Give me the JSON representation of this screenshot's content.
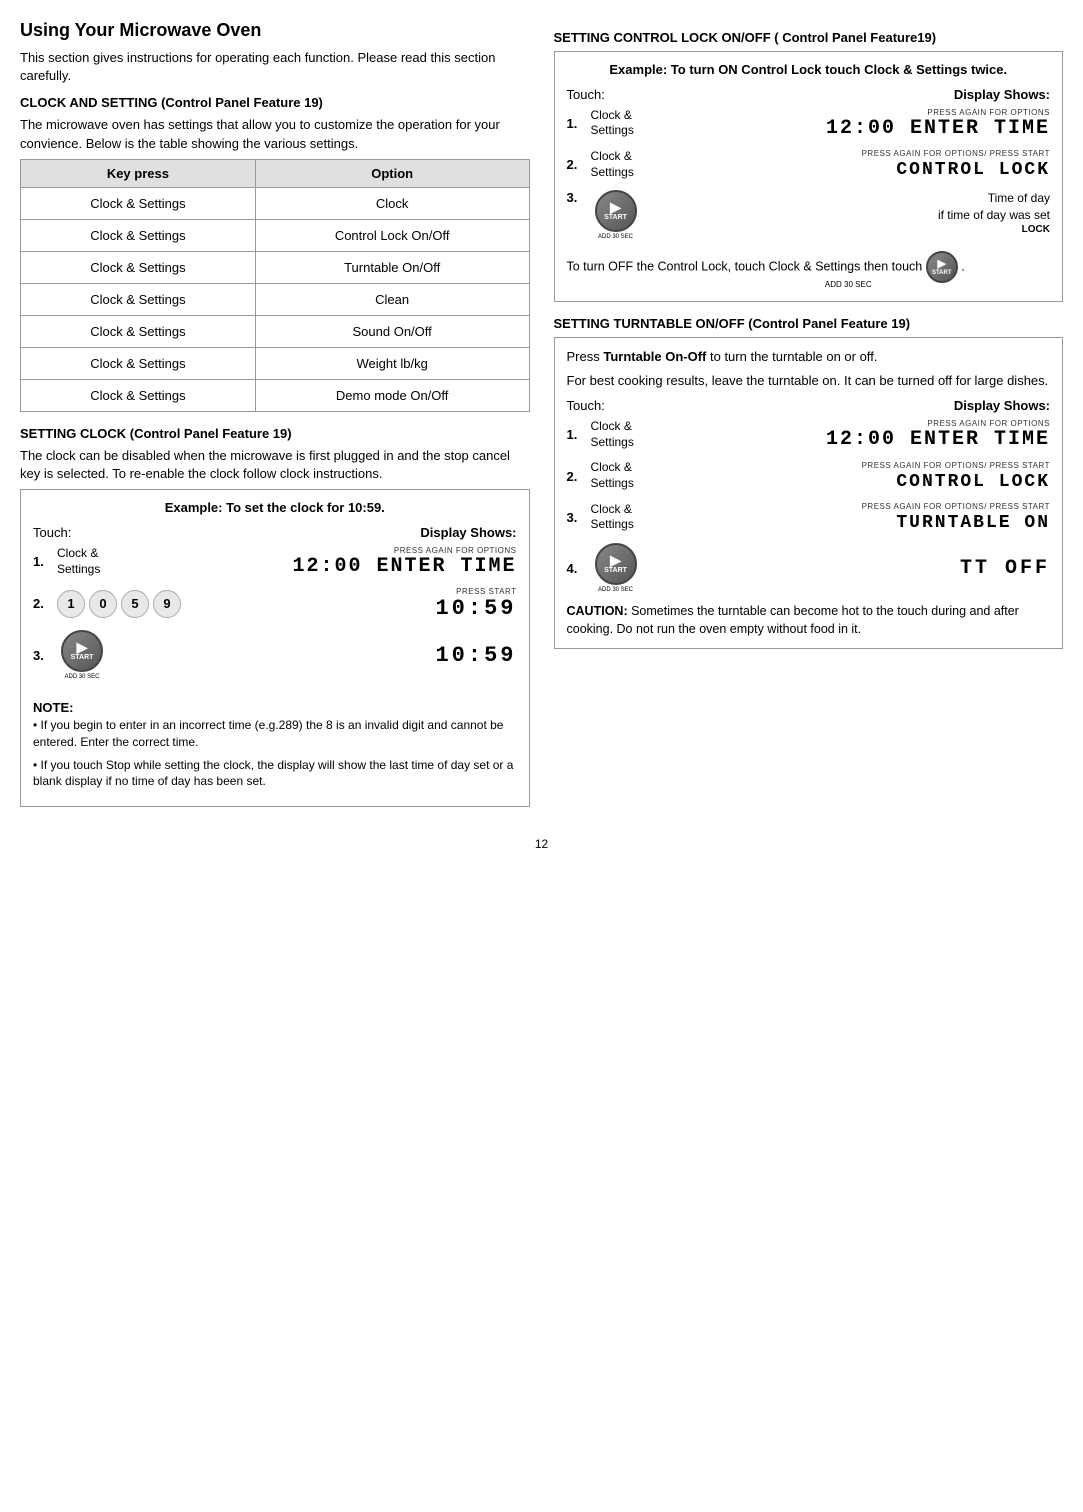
{
  "page": {
    "title": "Using Your Microwave Oven",
    "intro": "This section gives instructions for operating each function. Please read this section carefully.",
    "clock_section_title": "CLOCK AND SETTING (Control Panel Feature 19)",
    "clock_section_intro": "The microwave oven has settings that allow you to customize the operation for your convience. Below is the table showing the various settings.",
    "table": {
      "col1": "Key press",
      "col2": "Option",
      "rows": [
        [
          "Clock & Settings",
          "Clock"
        ],
        [
          "Clock & Settings",
          "Control Lock On/Off"
        ],
        [
          "Clock & Settings",
          "Turntable On/Off"
        ],
        [
          "Clock & Settings",
          "Clean"
        ],
        [
          "Clock & Settings",
          "Sound On/Off"
        ],
        [
          "Clock & Settings",
          "Weight lb/kg"
        ],
        [
          "Clock & Settings",
          "Demo mode On/Off"
        ]
      ]
    },
    "setting_clock_title": "SETTING CLOCK (Control Panel Feature 19)",
    "setting_clock_desc": "The clock can be disabled when the microwave is first plugged in and the stop cancel key is selected. To re-enable the clock follow clock instructions.",
    "clock_example": {
      "title": "Example: To set the clock for 10:59.",
      "touch_label": "Touch:",
      "display_label": "Display Shows:",
      "steps": [
        {
          "num": "1.",
          "touch": "Clock & Settings",
          "display_caption": "PRESS AGAIN FOR OPTIONS",
          "display_lcd": "12:00 ENTER TIME"
        },
        {
          "num": "2.",
          "touch": "num_keys",
          "keys": [
            "1",
            "0",
            "5",
            "9"
          ],
          "display_caption": "PRESS START",
          "display_lcd": "10:59"
        },
        {
          "num": "3.",
          "touch": "start",
          "display_lcd": "10:59"
        }
      ],
      "note_title": "NOTE:",
      "note_lines": [
        "• If you begin to enter in an incorrect time (e.g.289) the 8 is an invalid digit and cannot be entered. Enter the correct time.",
        "• If you touch Stop while setting the clock, the display will show the last time of day set or a blank display if no time of day has been set."
      ]
    }
  },
  "right": {
    "control_lock_title": "SETTING CONTROL LOCK ON/OFF ( Control Panel Feature19)",
    "control_lock_example": {
      "title": "Example: To turn ON Control Lock touch Clock & Settings twice.",
      "touch_label": "Touch:",
      "display_label": "Display Shows:",
      "steps": [
        {
          "num": "1.",
          "touch": "Clock & Settings",
          "display_caption": "PRESS AGAIN FOR OPTIONS",
          "display_lcd": "12:00 ENTER TIME"
        },
        {
          "num": "2.",
          "touch": "Clock & Settings",
          "display_caption": "PRESS AGAIN FOR OPTIONS/ PRESS START",
          "display_lcd": "CONTROL LOCK"
        },
        {
          "num": "3.",
          "touch": "start",
          "display_time_of_day": "Time of day",
          "display_if": "if time of day was set",
          "display_lock": "LOCK"
        }
      ],
      "turn_off_text": "To turn OFF the Control Lock, touch Clock & Settings then touch",
      "then_touch_end": "."
    },
    "turntable_title": "SETTING TURNTABLE ON/OFF (Control Panel Feature 19)",
    "turntable_desc1": "Press Turntable On-Off to turn the turntable on or off.",
    "turntable_desc2": "For best cooking results, leave the turntable on. It can be turned off for large dishes.",
    "turntable_example": {
      "touch_label": "Touch:",
      "display_label": "Display Shows:",
      "steps": [
        {
          "num": "1.",
          "touch": "Clock & Settings",
          "display_caption": "PRESS AGAIN FOR OPTIONS",
          "display_lcd": "12:00 ENTER TIME"
        },
        {
          "num": "2.",
          "touch": "Clock & Settings",
          "display_caption": "PRESS AGAIN FOR OPTIONS/ PRESS START",
          "display_lcd": "CONTROL LOCK"
        },
        {
          "num": "3.",
          "touch": "Clock & Settings",
          "display_caption": "PRESS AGAIN FOR OPTIONS/ PRESS START",
          "display_lcd": "TURNTABLE ON"
        },
        {
          "num": "4.",
          "touch": "start",
          "display_lcd": "TT OFF"
        }
      ]
    },
    "caution_title": "CAUTION:",
    "caution_text": "Sometimes the turntable can become hot to the touch during and after cooking. Do not run the oven empty without food in it."
  },
  "page_number": "12"
}
